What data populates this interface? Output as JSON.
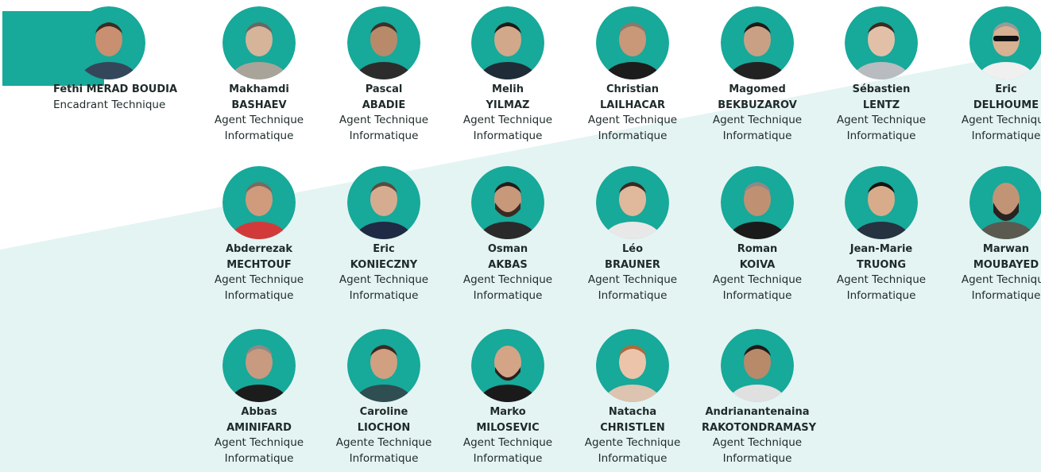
{
  "colors": {
    "accent": "#17a99a",
    "background_band": "#e4f4f2"
  },
  "lead": {
    "name": "Fethi MERAD BOUDIA",
    "role": "Encadrant Technique",
    "icon": "person-avatar-icon"
  },
  "members": [
    {
      "first": "Makhamdi",
      "last": "BASHAEV",
      "role1": "Agent Technique",
      "role2": "Informatique"
    },
    {
      "first": "Pascal",
      "last": "ABADIE",
      "role1": "Agent Technique",
      "role2": "Informatique"
    },
    {
      "first": "Melih",
      "last": "YILMAZ",
      "role1": "Agent Technique",
      "role2": "Informatique"
    },
    {
      "first": "Christian",
      "last": "LAILHACAR",
      "role1": "Agent Technique",
      "role2": "Informatique"
    },
    {
      "first": "Magomed",
      "last": "BEKBUZAROV",
      "role1": "Agent Technique",
      "role2": "Informatique"
    },
    {
      "first": "Sébastien",
      "last": "LENTZ",
      "role1": "Agent Technique",
      "role2": "Informatique"
    },
    {
      "first": "Eric",
      "last": "DELHOUME",
      "role1": "Agent Technique",
      "role2": "Informatique"
    },
    {
      "first": "Abderrezak",
      "last": "MECHTOUF",
      "role1": "Agent Technique",
      "role2": "Informatique"
    },
    {
      "first": "Eric",
      "last": "KONIECZNY",
      "role1": "Agent Technique",
      "role2": "Informatique"
    },
    {
      "first": "Osman",
      "last": "AKBAS",
      "role1": "Agent Technique",
      "role2": "Informatique"
    },
    {
      "first": "Léo",
      "last": "BRAUNER",
      "role1": "Agent Technique",
      "role2": "Informatique"
    },
    {
      "first": "Roman",
      "last": "KOIVA",
      "role1": "Agent Technique",
      "role2": "Informatique"
    },
    {
      "first": "Jean-Marie",
      "last": "TRUONG",
      "role1": "Agent Technique",
      "role2": "Informatique"
    },
    {
      "first": "Marwan",
      "last": "MOUBAYED",
      "role1": "Agent Technique",
      "role2": "Informatique"
    },
    {
      "first": "Abbas",
      "last": "AMINIFARD",
      "role1": "Agent Technique",
      "role2": "Informatique"
    },
    {
      "first": "Caroline",
      "last": "LIOCHON",
      "role1": "Agente Technique",
      "role2": "Informatique"
    },
    {
      "first": "Marko",
      "last": "MILOSEVIC",
      "role1": "Agent Technique",
      "role2": "Informatique"
    },
    {
      "first": "Natacha",
      "last": "CHRISTLEN",
      "role1": "Agente Technique",
      "role2": "Informatique"
    },
    {
      "first": "Andrianantenaina",
      "last": "RAKOTONDRAMASY",
      "role1": "Agent Technique",
      "role2": "Informatique"
    }
  ]
}
